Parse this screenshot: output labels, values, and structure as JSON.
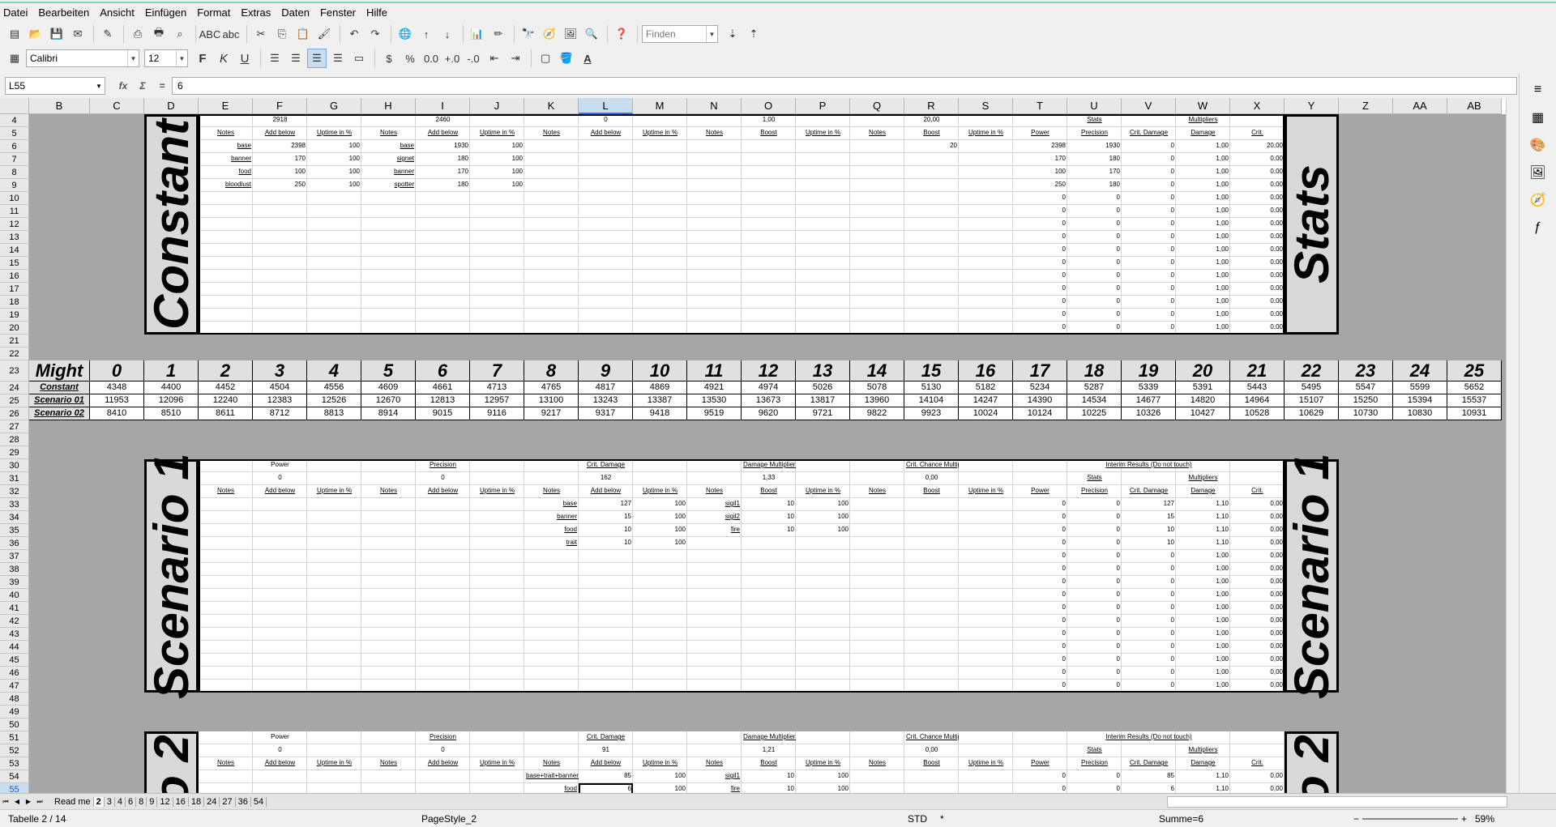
{
  "menu": [
    "Datei",
    "Bearbeiten",
    "Ansicht",
    "Einfügen",
    "Format",
    "Extras",
    "Daten",
    "Fenster",
    "Hilfe"
  ],
  "toolbar": {
    "find_placeholder": "Finden",
    "font": "Calibri",
    "size": "12"
  },
  "formula": {
    "cell_ref": "L55",
    "content": "6"
  },
  "columns": [
    "B",
    "C",
    "D",
    "E",
    "F",
    "G",
    "H",
    "I",
    "J",
    "K",
    "L",
    "M",
    "N",
    "O",
    "P",
    "Q",
    "R",
    "S",
    "T",
    "U",
    "V",
    "W",
    "X",
    "Y",
    "Z",
    "AA",
    "AB"
  ],
  "selected_column": "L",
  "rows": [
    "4",
    "5",
    "6",
    "7",
    "8",
    "9",
    "10",
    "11",
    "12",
    "13",
    "14",
    "15",
    "16",
    "17",
    "18",
    "19",
    "20",
    "21",
    "22",
    "23",
    "24",
    "25",
    "26",
    "27",
    "28",
    "29",
    "30",
    "31",
    "32",
    "33",
    "34",
    "35",
    "36",
    "37",
    "38",
    "39",
    "40",
    "41",
    "42",
    "43",
    "44",
    "45",
    "46",
    "47",
    "48",
    "49",
    "50",
    "51",
    "52",
    "53",
    "54",
    "55",
    "56"
  ],
  "selected_row": "55",
  "labels": {
    "constant": "Constant",
    "stats": "Stats",
    "scenario1": "Scenario 1",
    "scenario2": "o 2",
    "might": "Might"
  },
  "constant_block": {
    "row4": {
      "f": "2918",
      "i": "2460",
      "l": "0",
      "o": "1,00",
      "r": "20,00",
      "u": "Stats",
      "w": "Multipliers"
    },
    "row5": [
      "Notes",
      "Add below",
      "Uptime in %",
      "Notes",
      "Add below",
      "Uptime in %",
      "Notes",
      "Add below",
      "Uptime in %",
      "Notes",
      "Boost",
      "Uptime in %",
      "Notes",
      "Boost",
      "Uptime in %",
      "Power",
      "Precision",
      "Crit. Damage",
      "Damage",
      "Crit."
    ],
    "entries": [
      {
        "e": "base",
        "f": "2398",
        "g": "100",
        "h": "base",
        "i": "1930",
        "j": "100",
        "r": "20",
        "t": "2398",
        "u": "1930",
        "v": "0",
        "w": "1,00",
        "x": "20,00"
      },
      {
        "e": "banner",
        "f": "170",
        "g": "100",
        "h": "signet",
        "i": "180",
        "j": "100",
        "r": "",
        "t": "170",
        "u": "180",
        "v": "0",
        "w": "1,00",
        "x": "0,00"
      },
      {
        "e": "food",
        "f": "100",
        "g": "100",
        "h": "banner",
        "i": "170",
        "j": "100",
        "r": "",
        "t": "100",
        "u": "170",
        "v": "0",
        "w": "1,00",
        "x": "0,00"
      },
      {
        "e": "bloodlust",
        "f": "250",
        "g": "100",
        "h": "spotter",
        "i": "180",
        "j": "100",
        "r": "",
        "t": "250",
        "u": "180",
        "v": "0",
        "w": "1,00",
        "x": "0,00"
      }
    ]
  },
  "might_table": {
    "header": [
      "0",
      "1",
      "2",
      "3",
      "4",
      "5",
      "6",
      "7",
      "8",
      "9",
      "10",
      "11",
      "12",
      "13",
      "14",
      "15",
      "16",
      "17",
      "18",
      "19",
      "20",
      "21",
      "22",
      "23",
      "24",
      "25"
    ],
    "rows": [
      {
        "label": "Constant",
        "values": [
          "4348",
          "4400",
          "4452",
          "4504",
          "4556",
          "4609",
          "4661",
          "4713",
          "4765",
          "4817",
          "4869",
          "4921",
          "4974",
          "5026",
          "5078",
          "5130",
          "5182",
          "5234",
          "5287",
          "5339",
          "5391",
          "5443",
          "5495",
          "5547",
          "5599",
          "5652"
        ]
      },
      {
        "label": "Scenario 01",
        "values": [
          "11953",
          "12096",
          "12240",
          "12383",
          "12526",
          "12670",
          "12813",
          "12957",
          "13100",
          "13243",
          "13387",
          "13530",
          "13673",
          "13817",
          "13960",
          "14104",
          "14247",
          "14390",
          "14534",
          "14677",
          "14820",
          "14964",
          "15107",
          "15250",
          "15394",
          "15537"
        ]
      },
      {
        "label": "Scenario 02",
        "values": [
          "8410",
          "8510",
          "8611",
          "8712",
          "8813",
          "8914",
          "9015",
          "9116",
          "9217",
          "9317",
          "9418",
          "9519",
          "9620",
          "9721",
          "9822",
          "9923",
          "10024",
          "10124",
          "10225",
          "10326",
          "10427",
          "10528",
          "10629",
          "10730",
          "10830",
          "10931"
        ]
      }
    ]
  },
  "scenario1": {
    "row30": {
      "power": "Power",
      "precision": "Precision",
      "crit": "Crit. Damage",
      "dmg": "Damage Multipliers",
      "critchance": "Crit. Chance Multipliers",
      "interim": "Interim Results (Do not touch)"
    },
    "row31": {
      "f": "0",
      "i": "0",
      "l": "162",
      "o": "1,33",
      "r": "0,00",
      "u": "Stats",
      "w": "Multipliers"
    },
    "entries": [
      {
        "k": "base",
        "l": "127",
        "m": "100",
        "n": "sigil1",
        "o": "10",
        "p": "100",
        "v": "127",
        "w": "1,10"
      },
      {
        "k": "banner",
        "l": "15",
        "m": "100",
        "n": "sigil2",
        "o": "10",
        "p": "100",
        "v": "15",
        "w": "1,10"
      },
      {
        "k": "food",
        "l": "10",
        "m": "100",
        "n": "fire",
        "o": "10",
        "p": "100",
        "v": "10",
        "w": "1,10"
      },
      {
        "k": "trait",
        "l": "10",
        "m": "100",
        "n": "",
        "o": "",
        "p": "",
        "v": "10",
        "w": "1,10"
      }
    ]
  },
  "scenario2": {
    "row52": {
      "f": "0",
      "i": "0",
      "l": "91",
      "o": "1,21",
      "r": "0,00"
    },
    "entries": [
      {
        "k": "base+trait+banner",
        "l": "85",
        "m": "100",
        "n": "sigil1",
        "o": "10",
        "p": "100",
        "v": "85",
        "w": "1,10"
      },
      {
        "k": "food",
        "l": "6",
        "m": "100",
        "n": "fire",
        "o": "10",
        "p": "100",
        "v": "6",
        "w": "1,10"
      }
    ]
  },
  "sheet_tabs": [
    "Read me",
    "2",
    "3",
    "4",
    "6",
    "8",
    "9",
    "12",
    "16",
    "18",
    "24",
    "27",
    "36",
    "54"
  ],
  "active_tab": "2",
  "status": {
    "sheet": "Tabelle 2 / 14",
    "style": "PageStyle_2",
    "mode": "STD",
    "sum": "Summe=6",
    "zoom": "59%"
  }
}
